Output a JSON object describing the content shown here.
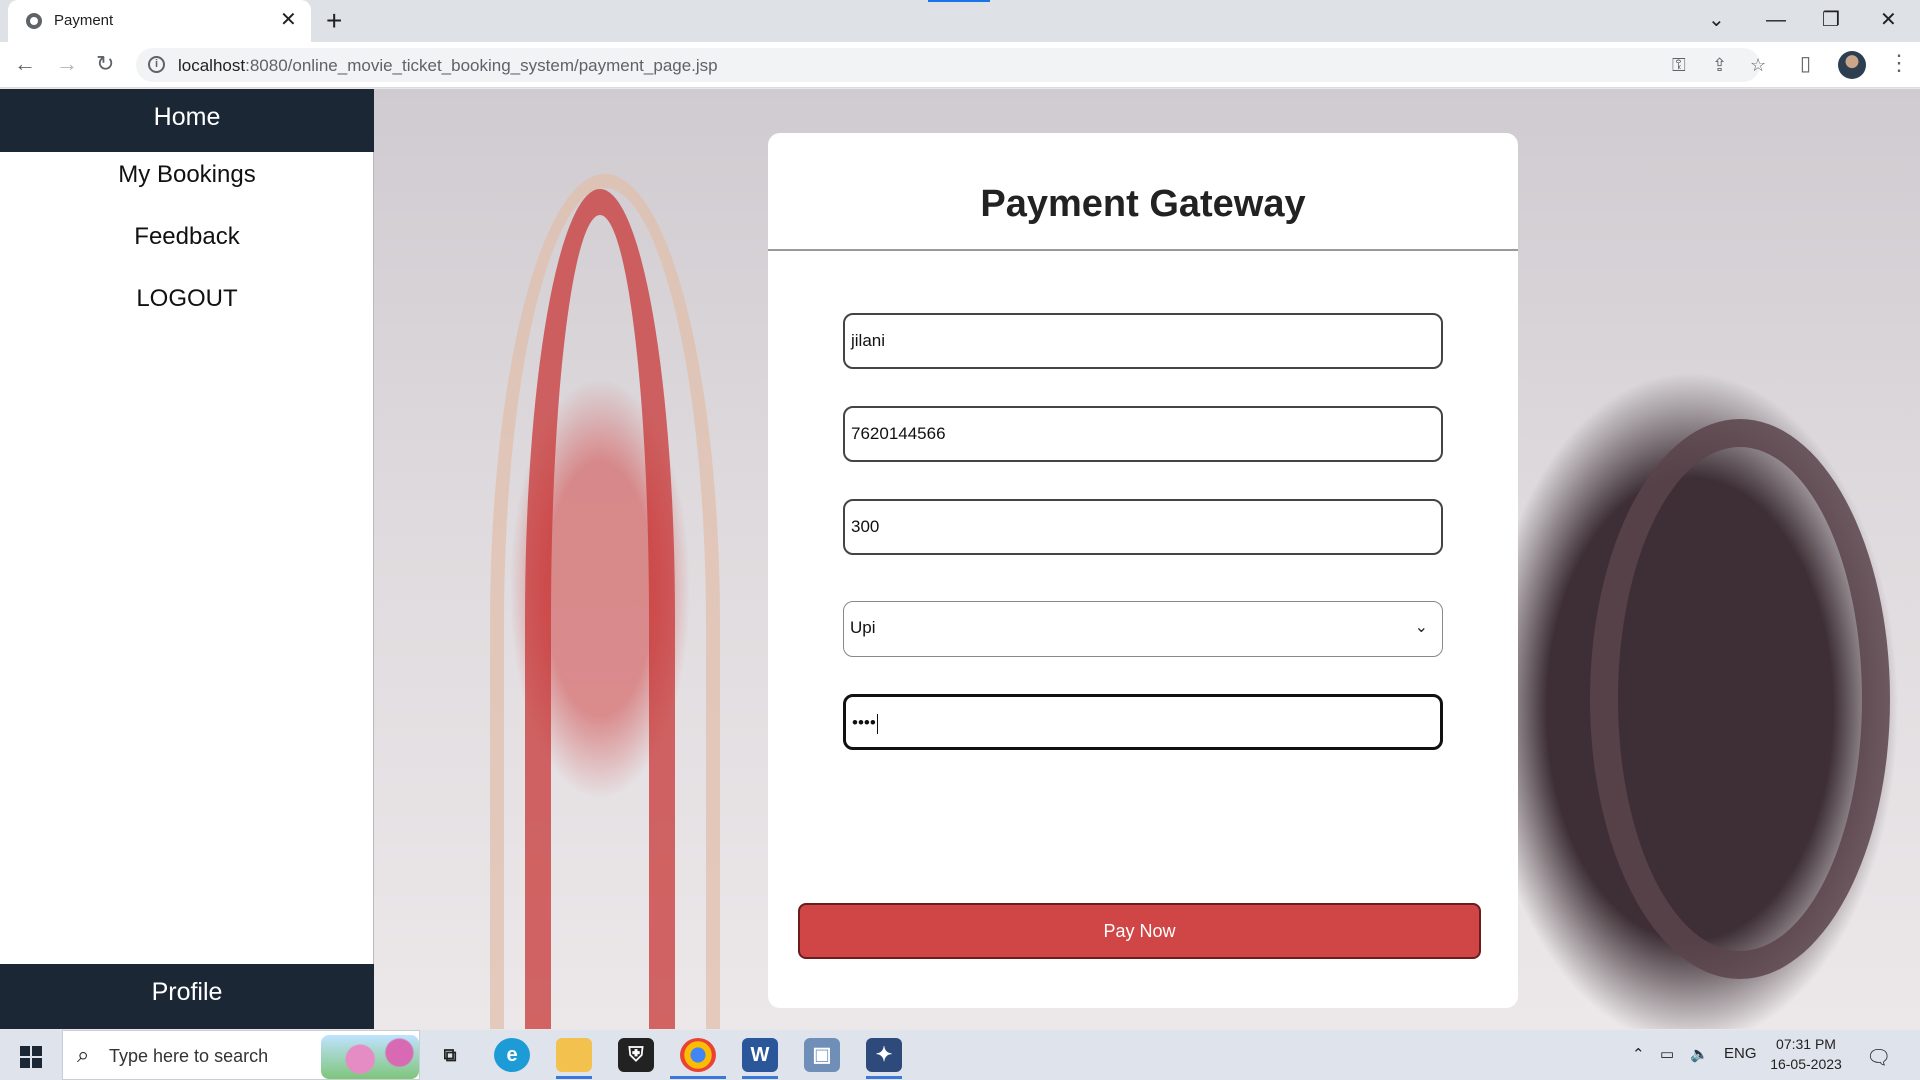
{
  "browser": {
    "tab_title": "Payment",
    "url_host": "localhost",
    "url_rest": ":8080/online_movie_ticket_booking_system/payment_page.jsp"
  },
  "sidebar": {
    "home": "Home",
    "items": [
      "My Bookings",
      "Feedback",
      "LOGOUT"
    ],
    "profile": "Profile"
  },
  "payment": {
    "title": "Payment Gateway",
    "name_value": "jilani",
    "phone_value": "7620144566",
    "amount_value": "300",
    "method_selected": "Upi",
    "pin_masked": "••••",
    "pay_button": "Pay Now"
  },
  "taskbar": {
    "search_placeholder": "Type here to search",
    "lang": "ENG",
    "time": "07:31 PM",
    "date": "16-05-2023"
  },
  "colors": {
    "sidebar_dark": "#1c2735",
    "pay_button": "#d04545",
    "chrome_blue": "#1a73e8"
  }
}
